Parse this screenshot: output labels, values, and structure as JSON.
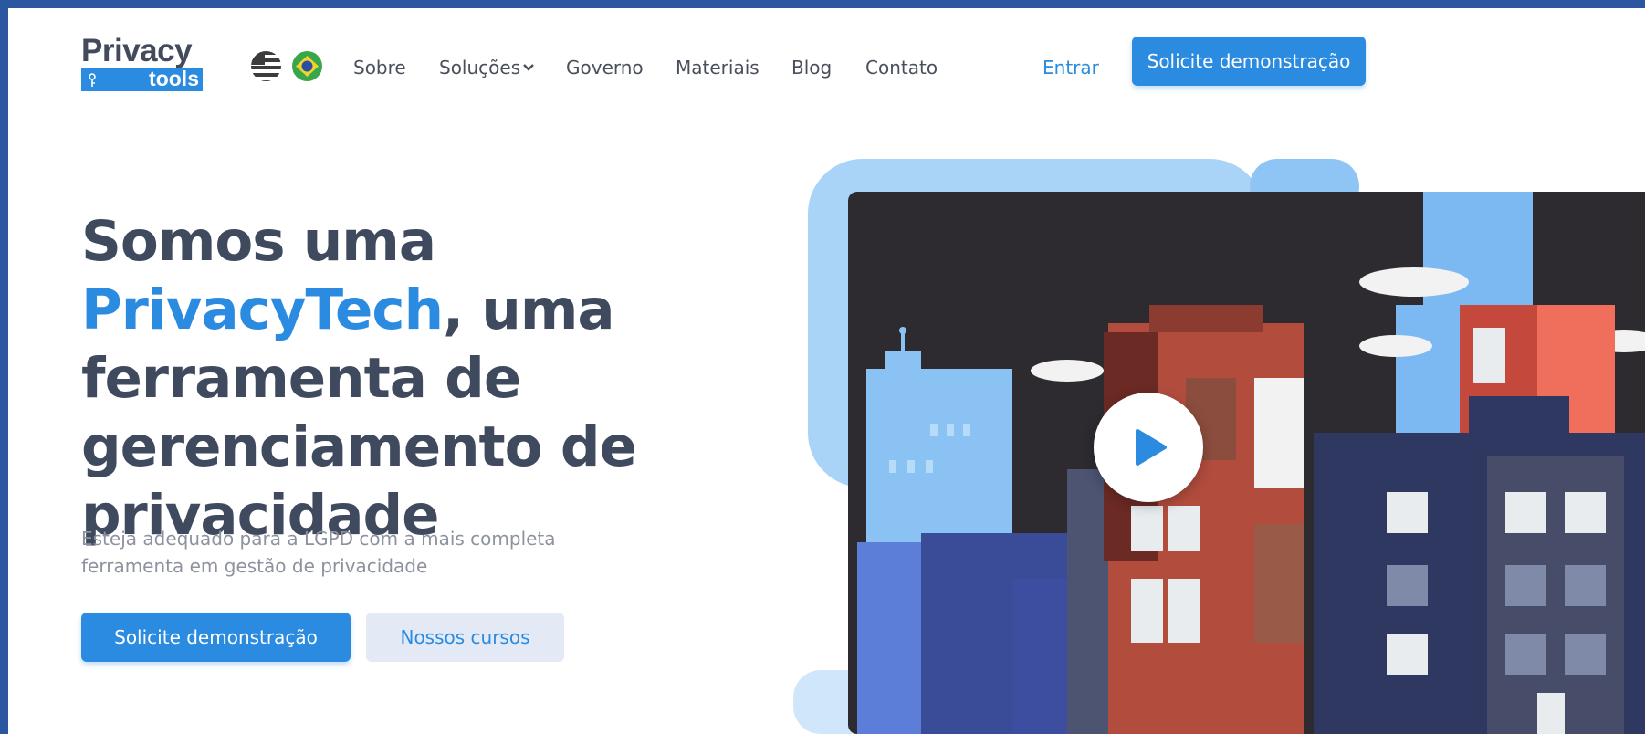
{
  "brand": {
    "logo_main": "Privacy",
    "logo_sub": "tools",
    "accent_color": "#2a8be0",
    "heading_color": "#3f4a5e"
  },
  "header": {
    "languages": [
      {
        "name": "flag-us-icon"
      },
      {
        "name": "flag-brazil-icon"
      }
    ],
    "nav": [
      {
        "label": "Sobre"
      },
      {
        "label": "Soluções"
      },
      {
        "label": "Governo"
      },
      {
        "label": "Materiais"
      },
      {
        "label": "Blog"
      },
      {
        "label": "Contato"
      }
    ],
    "login_label": "Entrar",
    "cta_label": "Solicite demonstração"
  },
  "hero": {
    "headline_part1": "Somos uma ",
    "headline_accent": "PrivacyTech",
    "headline_part2": ", uma ferramenta de gerenciamento de privacidade",
    "subtitle": "Esteja adequado para a LGPD com a mais completa ferramenta em gestão de privacidade",
    "primary_button": "Solicite demonstração",
    "secondary_button": "Nossos cursos"
  },
  "video": {
    "play_icon": "play-icon"
  }
}
